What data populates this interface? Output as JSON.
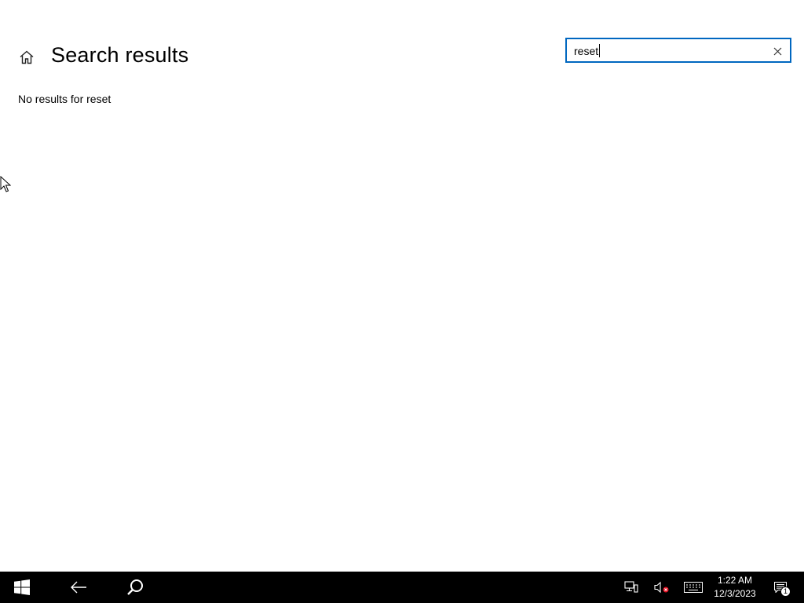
{
  "header": {
    "title": "Search results",
    "home_icon": "home-icon"
  },
  "search": {
    "value": "reset",
    "clear_icon": "close-icon"
  },
  "results": {
    "message": "No results for reset"
  },
  "taskbar": {
    "start_icon": "windows-logo-icon",
    "back_icon": "back-arrow-icon",
    "search_icon": "search-icon",
    "tray": {
      "network_icon": "network-icon",
      "volume_icon": "volume-muted-icon",
      "keyboard_icon": "keyboard-icon"
    },
    "clock": {
      "time": "1:22 AM",
      "date": "12/3/2023"
    },
    "notifications": {
      "icon": "action-center-icon",
      "count": "1"
    }
  },
  "colors": {
    "accent": "#0067c0",
    "taskbar": "#000000",
    "background": "#ffffff"
  }
}
